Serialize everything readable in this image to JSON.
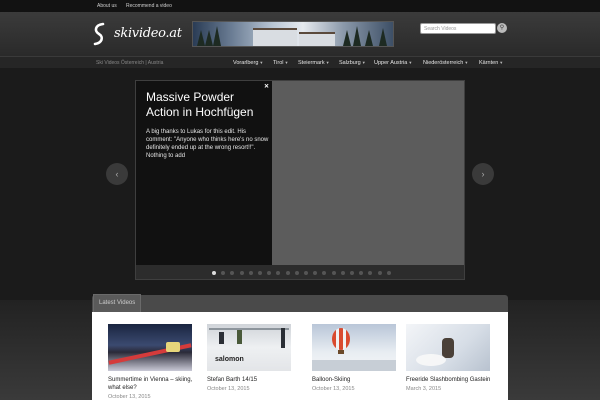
{
  "topbar": {
    "links": [
      "About us",
      "Recommend a video"
    ]
  },
  "brand": {
    "logo_text": "skivideo.at"
  },
  "search": {
    "placeholder": "Search Videos",
    "button_icon": "search-icon"
  },
  "navbar": {
    "tagline": "Ski Videos Österreich | Austria",
    "items": [
      "Vorarlberg",
      "Tirol",
      "Steiermark",
      "Salzburg",
      "Upper Austria",
      "Niederösterreich",
      "Kärnten"
    ]
  },
  "slider": {
    "title": "Massive Powder Action in Hochfügen",
    "description": "A big thanks to Lukas for this edit. His comment: \"Anyone who thinks here's no snow definitely ended up at the wrong resort!!\". Nothing to add",
    "close_icon": "close-icon",
    "prev_icon": "chevron-left-icon",
    "next_icon": "chevron-right-icon",
    "page_count": 20,
    "active_page": 1
  },
  "latest": {
    "tab_label": "Latest Videos",
    "videos": [
      {
        "title": "Summertime in Vienna – skiing, what else?",
        "date": "October 13, 2015"
      },
      {
        "title": "Stefan Barth 14/15",
        "date": "October 13, 2015",
        "thumb_text": "salomon"
      },
      {
        "title": "Balloon-Skiing",
        "date": "October 13, 2015"
      },
      {
        "title": "Freeride Slashbombing Gastein",
        "date": "March 3, 2015"
      }
    ]
  },
  "colors": {
    "background": "#1d1d1d",
    "accent": "#ffffff",
    "panel": "#111111"
  }
}
